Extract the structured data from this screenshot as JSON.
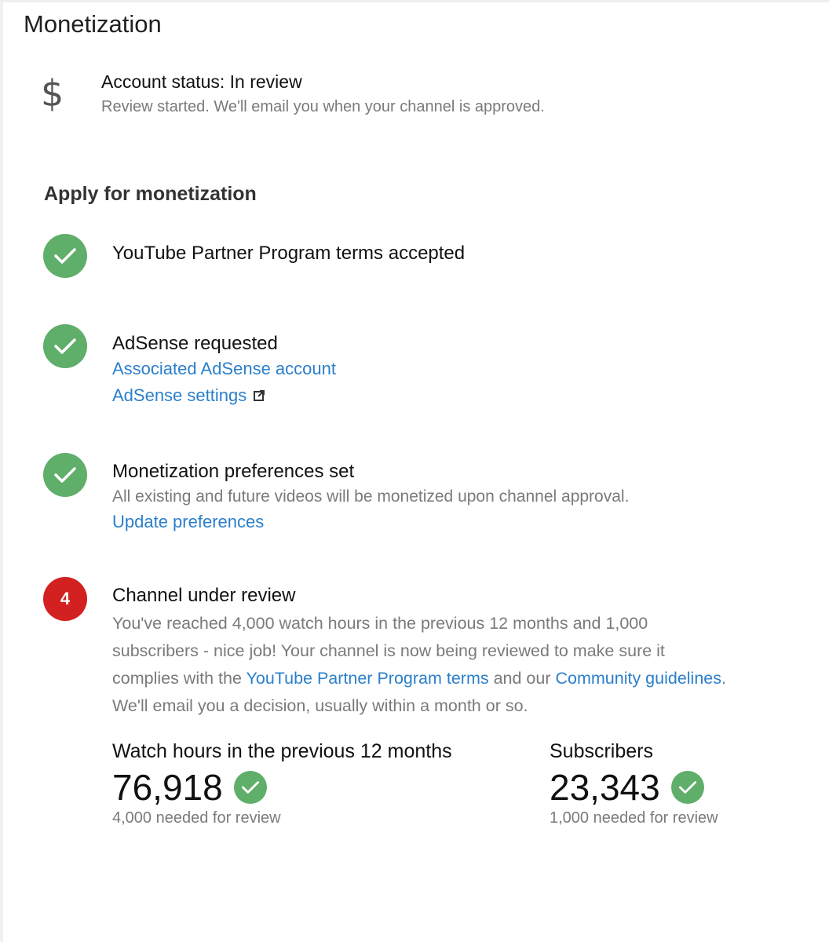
{
  "header": {
    "title": "Monetization"
  },
  "status": {
    "icon": "dollar-icon",
    "glyph": "$",
    "title": "Account status: In review",
    "subtitle": "Review started. We'll email you when your channel is approved."
  },
  "apply": {
    "title": "Apply for monetization",
    "steps": [
      {
        "state": "done",
        "title": "YouTube Partner Program terms accepted"
      },
      {
        "state": "done",
        "title": "AdSense requested",
        "links": [
          "Associated AdSense account",
          "AdSense settings"
        ]
      },
      {
        "state": "done",
        "title": "Monetization preferences set",
        "description": "All existing and future videos will be monetized upon channel approval.",
        "links": [
          "Update preferences"
        ]
      },
      {
        "state": "current",
        "number": "4",
        "title": "Channel under review",
        "description_parts": {
          "p1": "You've reached 4,000 watch hours in the previous 12 months and 1,000 subscribers - nice job! Your channel is now being reviewed to make sure it complies with the ",
          "link1": "YouTube Partner Program terms",
          "p2": " and our ",
          "link2": "Community guidelines",
          "p3": ". We'll email you a decision, usually within a month or so."
        }
      }
    ]
  },
  "metrics": {
    "watch_hours": {
      "label": "Watch hours in the previous 12 months",
      "value": "76,918",
      "note": "4,000 needed for review"
    },
    "subscribers": {
      "label": "Subscribers",
      "value": "23,343",
      "note": "1,000 needed for review"
    }
  },
  "colors": {
    "success": "#5fae6a",
    "alert": "#d32020",
    "link": "#2b7fcb",
    "muted": "#7a7a7a"
  }
}
